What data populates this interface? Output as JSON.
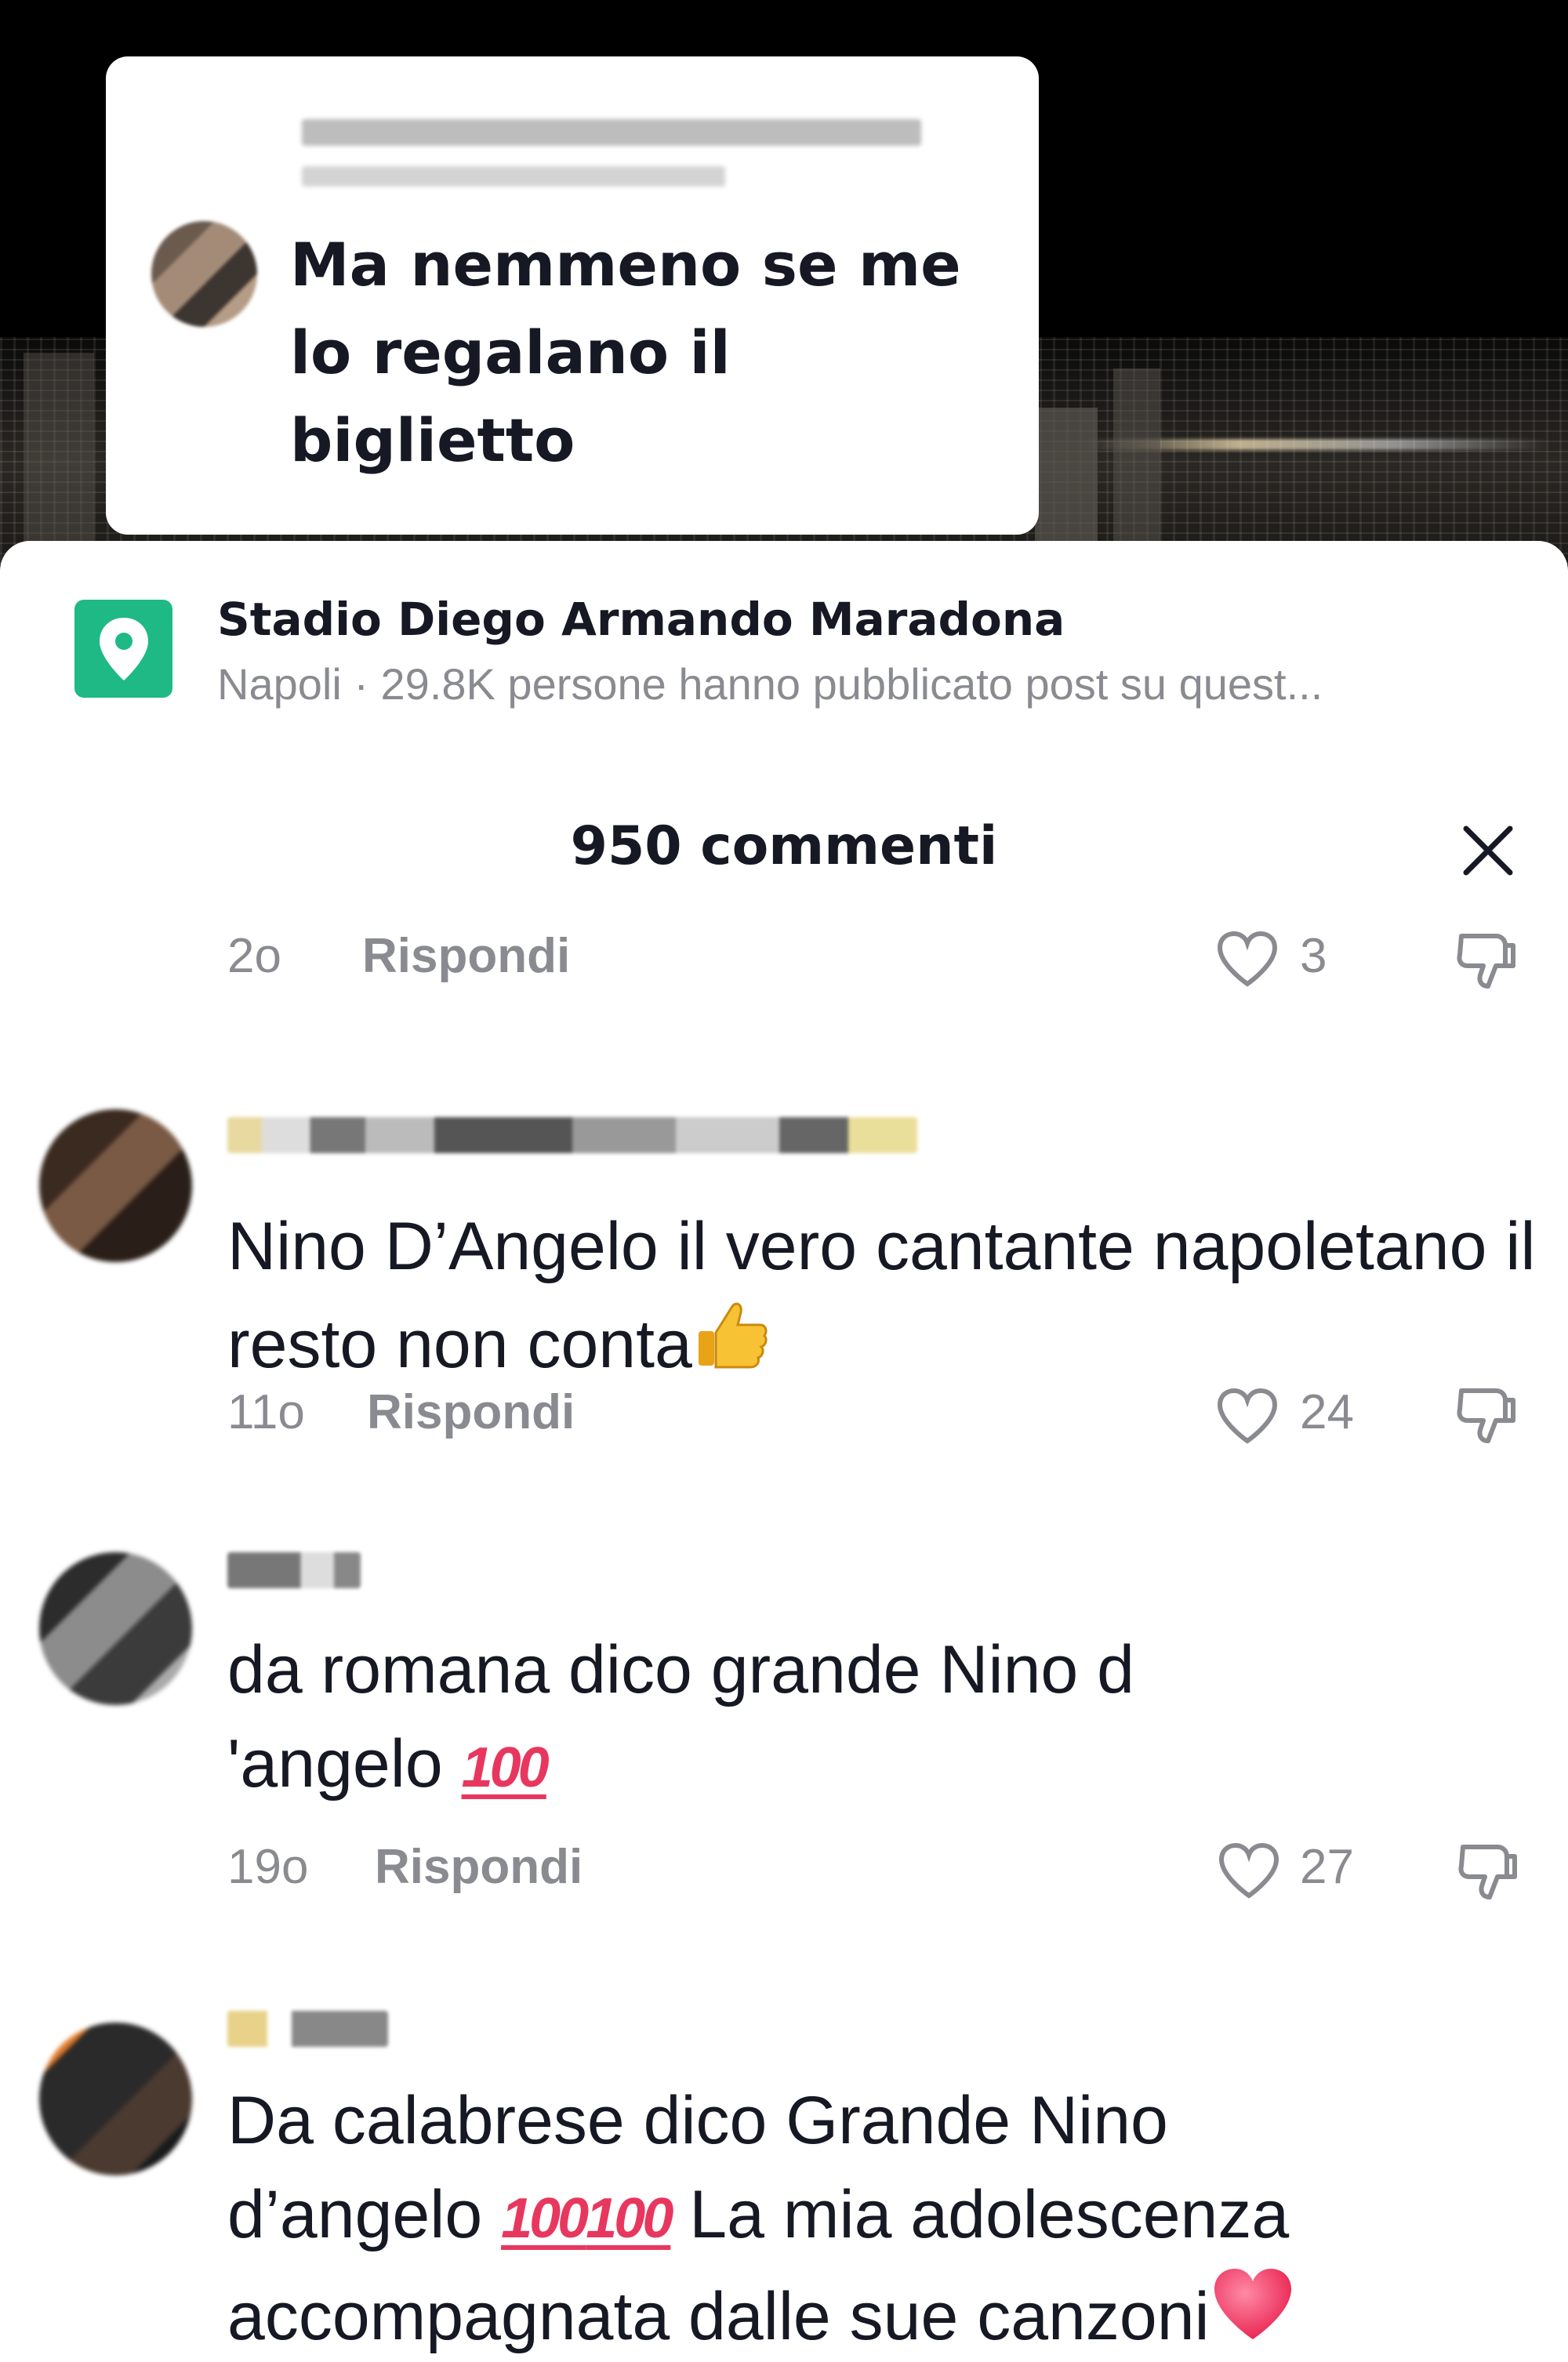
{
  "sticker": {
    "comment_text": "Ma nemmeno se me lo regalano il biglietto"
  },
  "location": {
    "name": "Stadio Diego Armando Maradona",
    "subtitle": "Napoli · 29.8K persone hanno pubblicato post su quest..."
  },
  "comments_header": {
    "title": "950 commenti"
  },
  "colors": {
    "location_pin_bg": "#1fb986",
    "muted_text": "#8a8b91",
    "text": "#161823",
    "emoji_red": "#e8375e"
  },
  "comments": [
    {
      "time": "2o",
      "reply_label": "Rispondi",
      "likes": "3"
    },
    {
      "text": "Nino D’Angelo il vero cantante napoletano il resto non conta",
      "trailing_emoji": "thumbs-up",
      "time": "11o",
      "reply_label": "Rispondi",
      "likes": "24"
    },
    {
      "text_line1": "da romana dico grande Nino d",
      "text_line2": "'angelo",
      "emoji_100": "100",
      "time": "19o",
      "reply_label": "Rispondi",
      "likes": "27"
    },
    {
      "text_line1": "Da calabrese dico Grande Nino",
      "text_line2_a": "d’angelo",
      "emoji_100": "100",
      "text_line2_b": "La mia adolescenza",
      "text_line3": "accompagnata dalle sue canzoni",
      "trailing_emoji": "red-heart"
    }
  ]
}
